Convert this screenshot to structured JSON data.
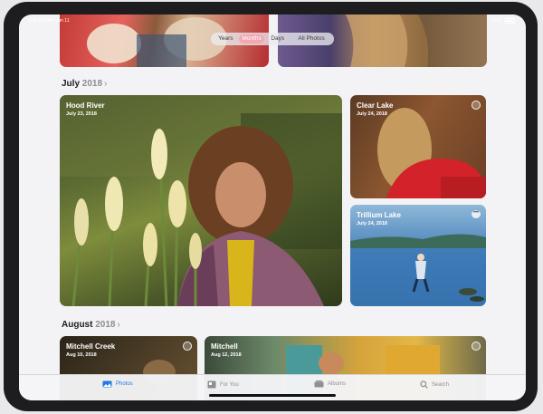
{
  "status_bar": {
    "time": "9:41 AM   Mon Jun 11",
    "battery": "100%"
  },
  "segments": {
    "options": [
      "Years",
      "Months",
      "Days",
      "All Photos"
    ],
    "selected": "Months"
  },
  "sections": [
    {
      "month": "July",
      "year": "2018",
      "chevron": "›"
    },
    {
      "month": "August",
      "year": "2018",
      "chevron": "›"
    }
  ],
  "cards": [
    {
      "title": "Hood River",
      "date": "July 23, 2018"
    },
    {
      "title": "Clear Lake",
      "date": "July 24, 2018"
    },
    {
      "title": "Trillium Lake",
      "date": "July 24, 2018"
    },
    {
      "title": "Mitchell Creek",
      "date": "Aug 10, 2018"
    },
    {
      "title": "Mitchell",
      "date": "Aug 12, 2018"
    }
  ],
  "tabs": [
    {
      "label": "Photos",
      "icon": "photos-icon",
      "active": true
    },
    {
      "label": "For You",
      "icon": "for-you-icon",
      "active": false
    },
    {
      "label": "Albums",
      "icon": "albums-icon",
      "active": false
    },
    {
      "label": "Search",
      "icon": "search-icon",
      "active": false
    }
  ],
  "colors": {
    "accent": "#1f7ae0",
    "segment_selected": "#f2a8b3"
  }
}
